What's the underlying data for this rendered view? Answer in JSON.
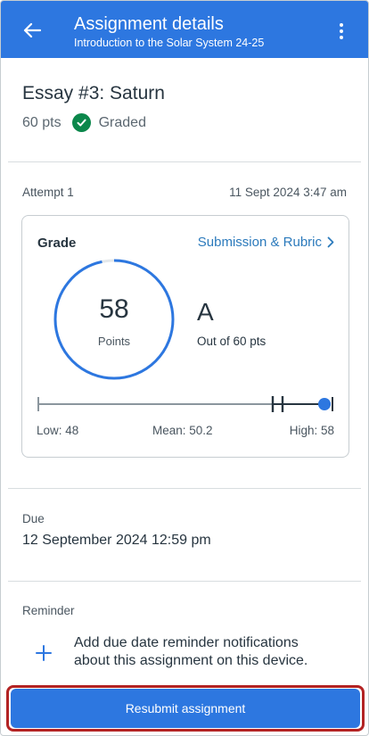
{
  "appbar": {
    "title": "Assignment details",
    "subtitle": "Introduction to the Solar System  24-25",
    "back_icon": "arrow-left-icon",
    "menu_icon": "more-vertical-icon"
  },
  "assignment": {
    "title": "Essay #3: Saturn",
    "points": "60 pts",
    "status": "Graded",
    "status_icon": "check-circle-icon",
    "status_color": "#0b874b"
  },
  "attempt": {
    "label": "Attempt 1",
    "date": "11 Sept 2024 3:47 am"
  },
  "grade": {
    "label": "Grade",
    "link_label": "Submission & Rubric",
    "points_value": "58",
    "points_label": "Points",
    "letter": "A",
    "out_of": "Out of 60 pts",
    "score_fraction": 0.9667,
    "accent_color": "#2d77e0",
    "range": {
      "low_label": "Low: 48",
      "mean_label": "Mean: 50.2",
      "high_label": "High: 58",
      "low": 48,
      "mean": 50.2,
      "high": 58,
      "score": 58
    }
  },
  "due": {
    "label": "Due",
    "value": "12 September 2024 12:59 pm"
  },
  "reminder": {
    "label": "Reminder",
    "text": "Add due date reminder notifications about this assignment on this device.",
    "icon": "plus-icon"
  },
  "actions": {
    "resubmit_label": "Resubmit assignment"
  }
}
